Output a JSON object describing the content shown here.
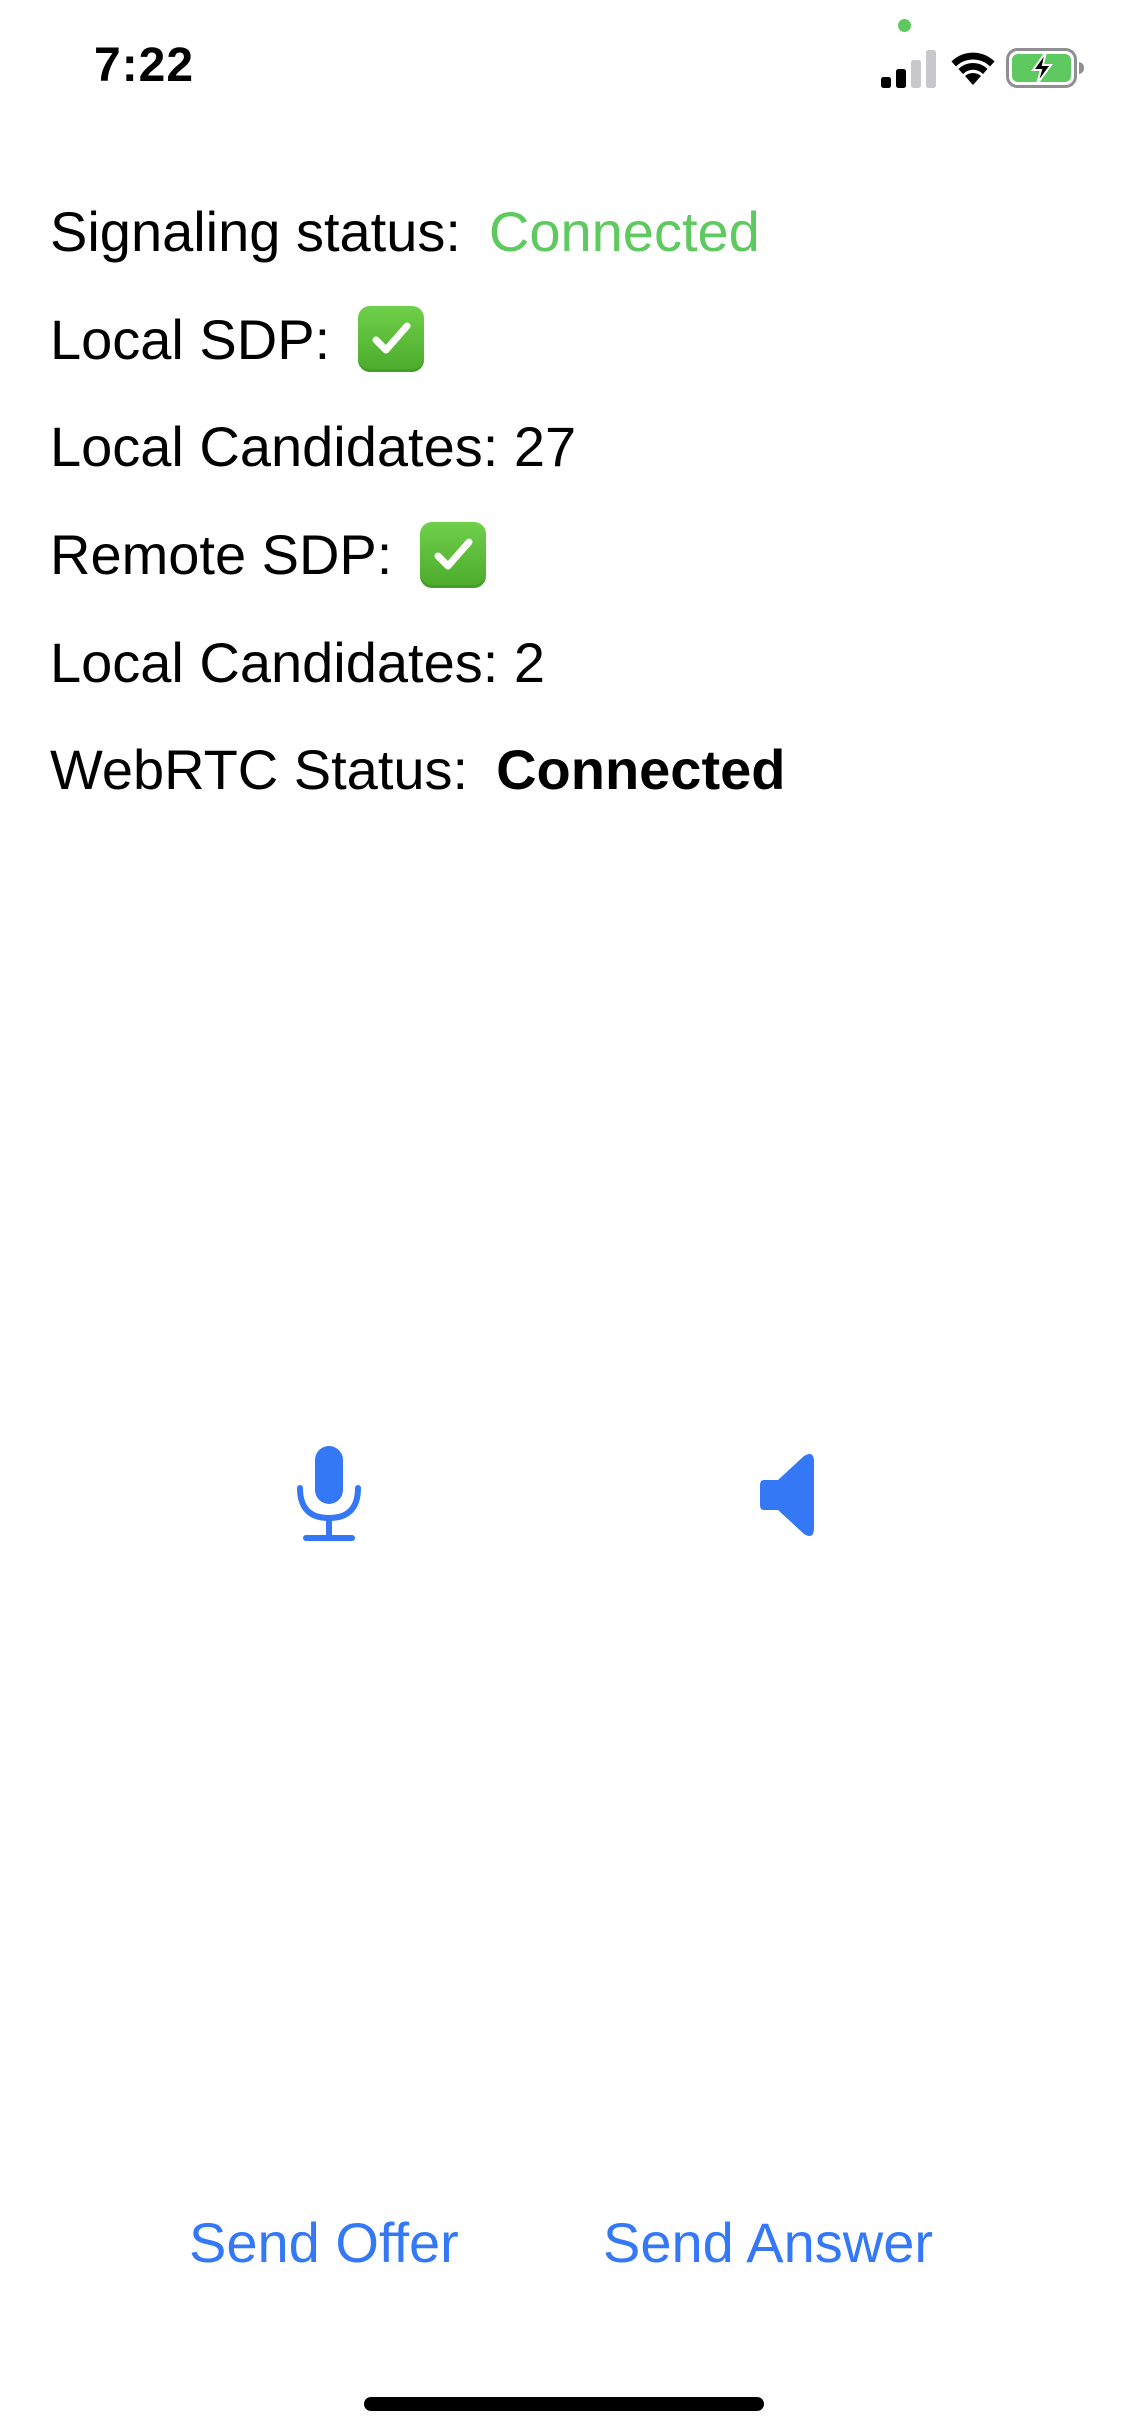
{
  "status_bar": {
    "time": "7:22",
    "signal_icon": "cellular-signal-icon",
    "wifi_icon": "wifi-icon",
    "battery_icon": "battery-charging-icon",
    "privacy_dot_color": "#5ec95e"
  },
  "info": {
    "signaling": {
      "label": "Signaling status:",
      "value": "Connected",
      "value_color": "#5ec95e"
    },
    "local_sdp": {
      "label": "Local SDP:",
      "icon": "check-mark-button-icon"
    },
    "local_candidates": {
      "text": "Local Candidates: 27"
    },
    "remote_sdp": {
      "label": "Remote SDP:",
      "icon": "check-mark-button-icon"
    },
    "remote_candidates": {
      "text": "Local Candidates: 2"
    },
    "webrtc": {
      "label": "WebRTC Status:",
      "value": "Connected"
    }
  },
  "controls": {
    "mic_icon": "microphone-icon",
    "speaker_icon": "speaker-icon",
    "accent_color": "#3478f6"
  },
  "actions": {
    "send_offer": "Send Offer",
    "send_answer": "Send Answer"
  }
}
